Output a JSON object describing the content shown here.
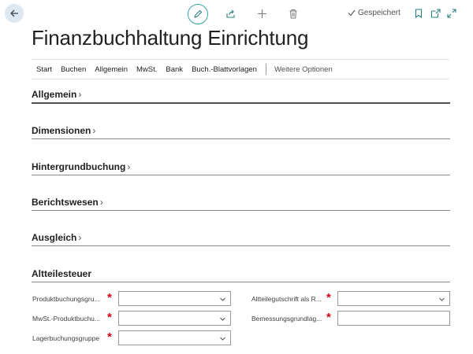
{
  "header": {
    "saved_label": "Gespeichert"
  },
  "page": {
    "title": "Finanzbuchhaltung Einrichtung"
  },
  "actions": {
    "items": [
      "Start",
      "Buchen",
      "Allgemein",
      "MwSt.",
      "Bank",
      "Buch.-Blattvorlagen"
    ],
    "more_label": "Weitere Optionen"
  },
  "sections": {
    "allgemein": "Allgemein",
    "dimensionen": "Dimensionen",
    "hintergrund": "Hintergrundbuchung",
    "berichtswesen": "Berichtswesen",
    "ausgleich": "Ausgleich",
    "altteilesteuer": "Altteilesteuer"
  },
  "fields": {
    "produktbuchungsgruppe": {
      "label": "Produktbuchungsgru...",
      "value": ""
    },
    "mwst_produktbuchung": {
      "label": "MwSt.-Produktbuchu...",
      "value": ""
    },
    "lagerbuchungsgruppe": {
      "label": "Lagerbuchungsgruppe",
      "value": ""
    },
    "altteilegutschrift": {
      "label": "Altteilegutschrift als R...",
      "value": ""
    },
    "bemessungsgrundlage": {
      "label": "Bemessungsgrundlag...",
      "value": ""
    }
  },
  "icons": {
    "back": "arrow-left-icon",
    "edit": "pencil-icon",
    "share": "share-icon",
    "add": "plus-icon",
    "delete": "trash-icon",
    "saved": "checkmark-icon",
    "bookmark": "bookmark-icon",
    "open_new": "open-in-new-window-icon",
    "expand": "expand-icon"
  },
  "colors": {
    "accent": "#3aa3a3",
    "required": "#d0021b",
    "back_button_bg": "#dde8f0"
  }
}
